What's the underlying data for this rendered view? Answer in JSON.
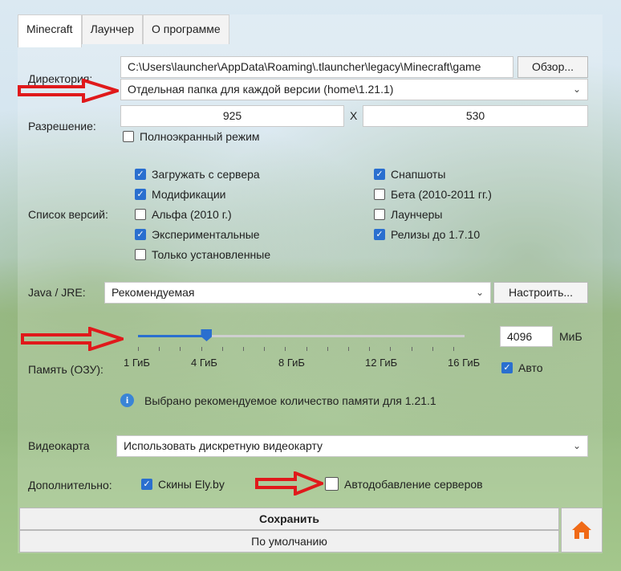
{
  "tabs": [
    {
      "label": "Minecraft"
    },
    {
      "label": "Лаунчер"
    },
    {
      "label": "О программе"
    }
  ],
  "directory": {
    "label": "Директория:",
    "path": "C:\\Users\\launcher\\AppData\\Roaming\\.tlauncher\\legacy\\Minecraft\\game",
    "browse_label": "Обзор...",
    "mode_value": "Отдельная папка для каждой версии (home\\1.21.1)"
  },
  "resolution": {
    "label": "Разрешение:",
    "width": "925",
    "separator": "X",
    "height": "530",
    "fullscreen_label": "Полноэкранный режим",
    "fullscreen_checked": false
  },
  "versions": {
    "label": "Список версий:",
    "left": [
      {
        "label": "Загружать с сервера",
        "checked": true
      },
      {
        "label": "Модификации",
        "checked": true
      },
      {
        "label": "Альфа (2010 г.)",
        "checked": false
      },
      {
        "label": "Экспериментальные",
        "checked": true
      },
      {
        "label": "Только установленные",
        "checked": false
      }
    ],
    "right": [
      {
        "label": "Снапшоты",
        "checked": true
      },
      {
        "label": "Бета (2010-2011 гг.)",
        "checked": false
      },
      {
        "label": "Лаунчеры",
        "checked": false
      },
      {
        "label": "Релизы до 1.7.10",
        "checked": true
      }
    ]
  },
  "java": {
    "label": "Java / JRE:",
    "value": "Рекомендуемая",
    "configure_label": "Настроить..."
  },
  "memory": {
    "label": "Память (ОЗУ):",
    "value": "4096",
    "unit": "МиБ",
    "auto_label": "Авто",
    "auto_checked": true,
    "slider_fraction": 0.21,
    "ticks": [
      "1 ГиБ",
      "4 ГиБ",
      "8 ГиБ",
      "12 ГиБ",
      "16 ГиБ"
    ],
    "info_text": "Выбрано рекомендуемое количество памяти для 1.21.1"
  },
  "gpu": {
    "label": "Видеокарта",
    "value": "Использовать дискретную видеокарту"
  },
  "extra": {
    "label": "Дополнительно:",
    "ely_label": "Скины Ely.by",
    "ely_checked": true,
    "autoservers_label": "Автодобавление серверов",
    "autoservers_checked": false
  },
  "buttons": {
    "save_label": "Сохранить",
    "default_label": "По умолчанию"
  },
  "colors": {
    "accent": "#2a6fcf",
    "arrow": "#e0191b",
    "home_icon": "#f06a17"
  }
}
